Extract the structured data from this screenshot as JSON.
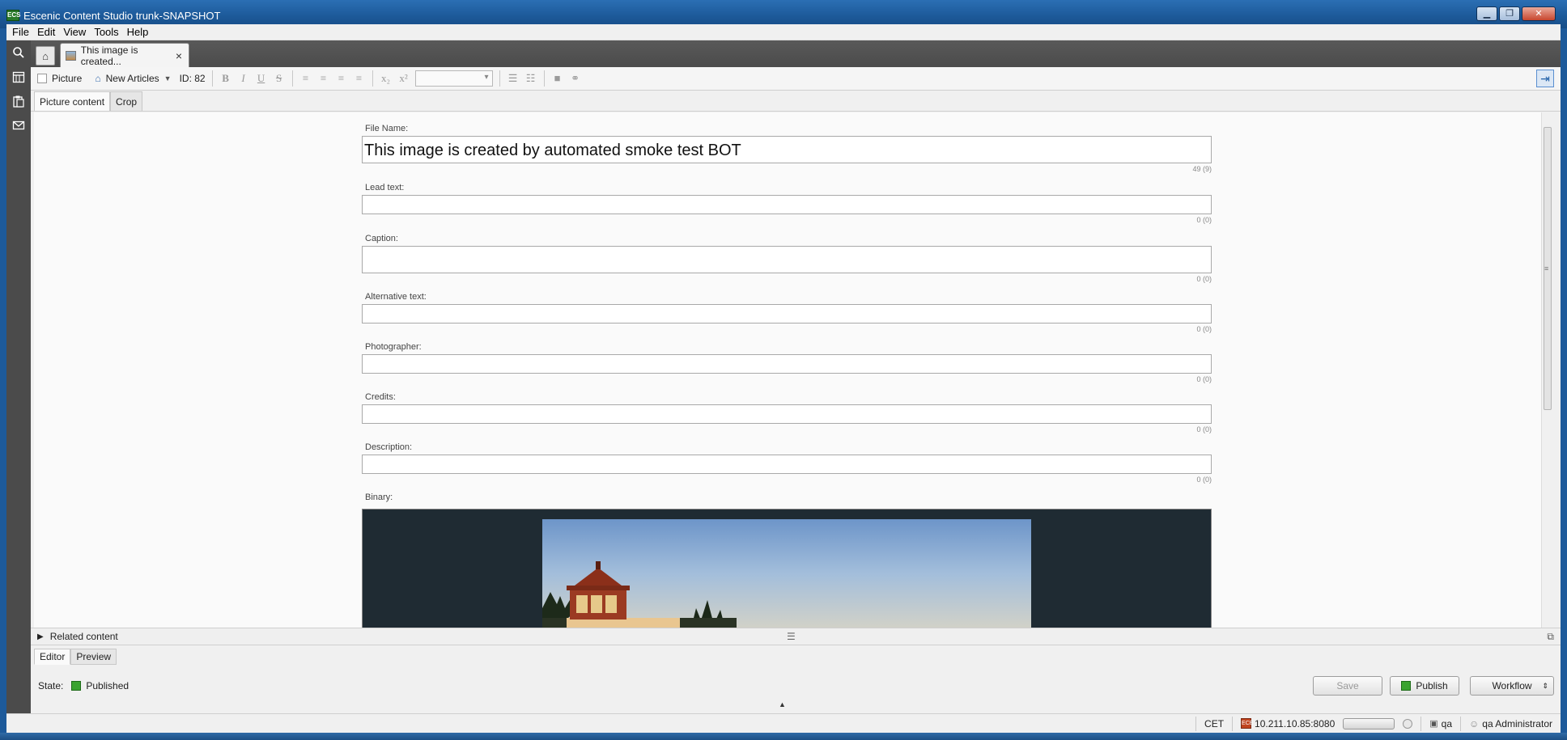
{
  "window": {
    "title": "Escenic Content Studio trunk-SNAPSHOT",
    "icon_text": "ECS"
  },
  "menu": [
    "File",
    "Edit",
    "View",
    "Tools",
    "Help"
  ],
  "leftbar": {
    "icons": [
      "search-icon",
      "calendar-icon",
      "clipboard-icon",
      "mail-icon"
    ]
  },
  "tabs": {
    "doc_tab_label": "This image is created...",
    "close": "×"
  },
  "toolbar": {
    "type_label": "Picture",
    "section_label": "New Articles",
    "id_label": "ID: 82"
  },
  "subtabs": [
    "Picture content",
    "Crop"
  ],
  "form": {
    "filename": {
      "label": "File Name:",
      "value": "This image is created by automated smoke test BOT",
      "counter": "49 (9)"
    },
    "lead": {
      "label": "Lead text:",
      "counter": "0 (0)"
    },
    "caption": {
      "label": "Caption:",
      "counter": "0 (0)"
    },
    "alt": {
      "label": "Alternative text:",
      "counter": "0 (0)"
    },
    "photographer": {
      "label": "Photographer:",
      "counter": "0 (0)"
    },
    "credits": {
      "label": "Credits:",
      "counter": "0 (0)"
    },
    "description": {
      "label": "Description:",
      "counter": "0 (0)"
    },
    "binary": {
      "label": "Binary:"
    }
  },
  "related": {
    "label": "Related content"
  },
  "editor_tabs": [
    "Editor",
    "Preview"
  ],
  "status": {
    "state_label": "State:",
    "state_value": "Published",
    "state_color": "#3aa32f",
    "save": "Save",
    "publish": "Publish",
    "workflow": "Workflow"
  },
  "bottombar": {
    "timezone": "CET",
    "server": "10.211.10.85:8080",
    "publication": "qa",
    "user": "qa Administrator"
  }
}
